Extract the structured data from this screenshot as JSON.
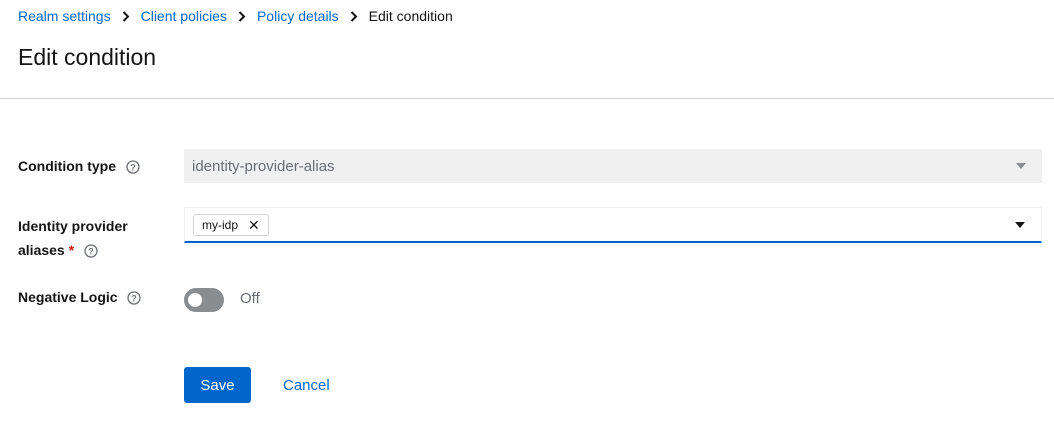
{
  "breadcrumb": {
    "items": [
      {
        "label": "Realm settings"
      },
      {
        "label": "Client policies"
      },
      {
        "label": "Policy details"
      }
    ],
    "current": "Edit condition"
  },
  "page": {
    "title": "Edit condition"
  },
  "form": {
    "condition_type": {
      "label": "Condition type",
      "value": "identity-provider-alias",
      "disabled": true
    },
    "identity_provider_aliases": {
      "label_line1": "Identity provider",
      "label_line2": "aliases",
      "required_mark": "*",
      "chips": [
        "my-idp"
      ]
    },
    "negative_logic": {
      "label": "Negative Logic",
      "state_label": "Off",
      "on": false
    }
  },
  "actions": {
    "save_label": "Save",
    "cancel_label": "Cancel"
  },
  "colors": {
    "accent": "#0066cc",
    "required": "#c9190b",
    "switch_off": "#8a8d90"
  }
}
